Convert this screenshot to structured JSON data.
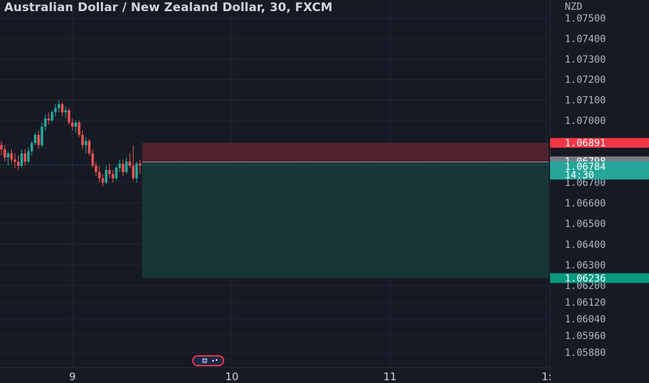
{
  "header": {
    "title": "Australian Dollar / New Zealand Dollar, 30, FXCM",
    "currency": "NZD"
  },
  "colors": {
    "background": "#161a25",
    "up": "#26a69a",
    "down": "#ef5350",
    "stop_zone": "#5c2330",
    "target_zone": "#163a38",
    "grid": "#232733"
  },
  "chart_data": {
    "type": "candlestick",
    "timeframe": "30",
    "symbol": "AUDNZD",
    "ylim": [
      1.0585,
      1.0757
    ],
    "y_ticks": [
      "1.07500",
      "1.07400",
      "1.07300",
      "1.07200",
      "1.07100",
      "1.07000",
      "1.06700",
      "1.06600",
      "1.06500",
      "1.06400",
      "1.06300",
      "1.06200",
      "1.06120",
      "1.06040",
      "1.05960",
      "1.05880"
    ],
    "x_ticks": [
      "9",
      "10",
      "11",
      "1:"
    ],
    "last_price": "1.06784",
    "countdown": "14:30",
    "position": {
      "entry": "1.06798",
      "stop": "1.06891",
      "target": "1.06236"
    },
    "candles": [
      [
        1.0688,
        1.069,
        1.0683,
        1.0686
      ],
      [
        1.0686,
        1.0688,
        1.068,
        1.0682
      ],
      [
        1.0682,
        1.0685,
        1.0678,
        1.0684
      ],
      [
        1.0684,
        1.0686,
        1.0679,
        1.0681
      ],
      [
        1.0681,
        1.0684,
        1.0677,
        1.068
      ],
      [
        1.068,
        1.0683,
        1.0676,
        1.0678
      ],
      [
        1.0678,
        1.0686,
        1.0677,
        1.0684
      ],
      [
        1.0684,
        1.0686,
        1.0678,
        1.068
      ],
      [
        1.068,
        1.0687,
        1.0679,
        1.0685
      ],
      [
        1.0685,
        1.069,
        1.0683,
        1.0689
      ],
      [
        1.0689,
        1.0694,
        1.0688,
        1.0693
      ],
      [
        1.0693,
        1.0695,
        1.0686,
        1.0688
      ],
      [
        1.0688,
        1.0699,
        1.0687,
        1.0697
      ],
      [
        1.0697,
        1.0703,
        1.0695,
        1.0701
      ],
      [
        1.0701,
        1.0704,
        1.0698,
        1.07
      ],
      [
        1.07,
        1.0705,
        1.0699,
        1.0704
      ],
      [
        1.0704,
        1.0708,
        1.0702,
        1.0706
      ],
      [
        1.0706,
        1.071,
        1.0704,
        1.0708
      ],
      [
        1.0708,
        1.0709,
        1.0702,
        1.0704
      ],
      [
        1.0704,
        1.0707,
        1.0701,
        1.0705
      ],
      [
        1.0705,
        1.0706,
        1.0698,
        1.0699
      ],
      [
        1.0699,
        1.0701,
        1.0695,
        1.0697
      ],
      [
        1.0697,
        1.07,
        1.0694,
        1.0699
      ],
      [
        1.0699,
        1.07,
        1.0692,
        1.0693
      ],
      [
        1.0693,
        1.0695,
        1.0686,
        1.0688
      ],
      [
        1.0688,
        1.0692,
        1.0684,
        1.069
      ],
      [
        1.069,
        1.0691,
        1.0683,
        1.0684
      ],
      [
        1.0684,
        1.0686,
        1.0677,
        1.0678
      ],
      [
        1.0678,
        1.068,
        1.0673,
        1.0675
      ],
      [
        1.0675,
        1.0678,
        1.067,
        1.0672
      ],
      [
        1.0672,
        1.0674,
        1.0668,
        1.067
      ],
      [
        1.067,
        1.0678,
        1.0669,
        1.0676
      ],
      [
        1.0676,
        1.0679,
        1.0672,
        1.0674
      ],
      [
        1.0674,
        1.0676,
        1.067,
        1.0672
      ],
      [
        1.0672,
        1.0678,
        1.0671,
        1.0677
      ],
      [
        1.0677,
        1.0681,
        1.0675,
        1.0679
      ],
      [
        1.0679,
        1.0681,
        1.0673,
        1.0675
      ],
      [
        1.0675,
        1.0682,
        1.0674,
        1.068
      ],
      [
        1.068,
        1.0684,
        1.0677,
        1.0678
      ],
      [
        1.0678,
        1.0688,
        1.0671,
        1.0672
      ],
      [
        1.0672,
        1.068,
        1.067,
        1.0679
      ],
      [
        1.0679,
        1.0681,
        1.0674,
        1.0678
      ]
    ]
  }
}
